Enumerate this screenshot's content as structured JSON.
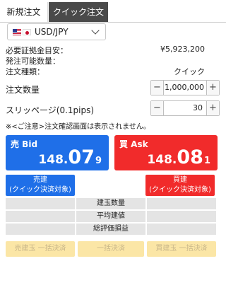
{
  "tabs": {
    "new_order": "新規注文",
    "quick_order": "クイック注文"
  },
  "pair": {
    "label": "USD/JPY",
    "flags": [
      "us-flag-icon",
      "jp-flag-icon"
    ]
  },
  "info": {
    "margin_label": "必要証拠金目安：",
    "margin_value": "¥5,923,200",
    "orderable_label": "発注可能数量：",
    "orderable_value": "",
    "type_label": "注文種類：",
    "type_value": "クイック"
  },
  "quantity": {
    "label": "注文数量",
    "value": "1,000,000",
    "minus": "−",
    "plus": "+"
  },
  "slippage": {
    "label": "スリッページ(0.1pips)",
    "value": "30",
    "minus": "−",
    "plus": "+"
  },
  "notice": "※<ご注意>注文確認画面は表示されません。",
  "bid": {
    "side_label": "売 Bid",
    "price_head": "148.",
    "price_big": "07",
    "price_pip": "9"
  },
  "ask": {
    "side_label": "買 Ask",
    "price_head": "148.",
    "price_big": "08",
    "price_pip": "1"
  },
  "positions": {
    "sell_line1": "売建",
    "sell_line2": "(クイック決済対象)",
    "buy_line1": "買建",
    "buy_line2": "(クイック決済対象)",
    "rows": [
      "建玉数量",
      "平均建値",
      "総評価損益"
    ]
  },
  "bulk": {
    "sell_all": "売建玉 一括決済",
    "all": "一括決済",
    "buy_all": "買建玉 一括決済"
  },
  "colors": {
    "bid": "#1f6fe8",
    "ask": "#f12b2b",
    "tab_active": "#4a4a4a",
    "bulk_bg": "#fbe6a6"
  }
}
